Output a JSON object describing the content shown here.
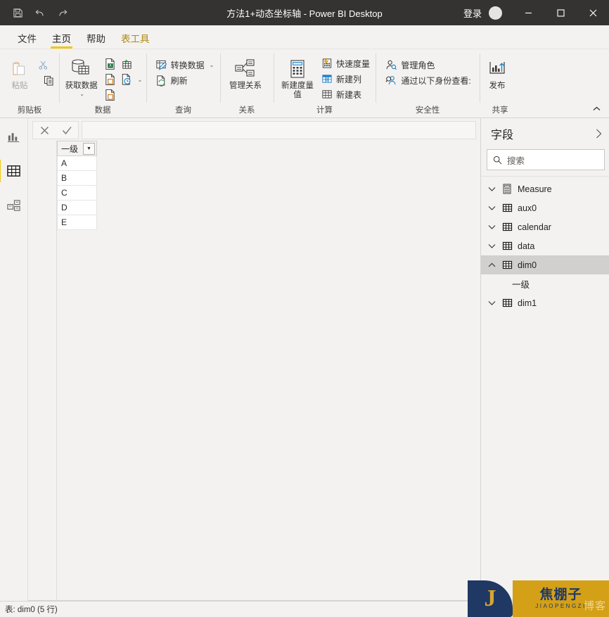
{
  "titlebar": {
    "save_icon": "save-icon",
    "undo_icon": "undo-icon",
    "redo_icon": "redo-icon",
    "title": "方法1+动态坐标轴 - Power BI Desktop",
    "signin_label": "登录",
    "minimize_label": "—",
    "maximize_label": "☐",
    "close_label": "✕"
  },
  "tabs": [
    {
      "label": "文件",
      "active": false,
      "tools": false
    },
    {
      "label": "主页",
      "active": true,
      "tools": false
    },
    {
      "label": "帮助",
      "active": false,
      "tools": false
    },
    {
      "label": "表工具",
      "active": false,
      "tools": true
    }
  ],
  "ribbon": {
    "collapse_icon": "chevron-up-icon",
    "groups": [
      {
        "name": "clipboard",
        "label": "剪贴板",
        "big_buttons": [
          {
            "label": "粘贴",
            "icon": "paste-icon",
            "disabled": true
          }
        ],
        "small_buttons": [
          {
            "label": "",
            "icon": "cut-scissors-icon"
          },
          {
            "label": "",
            "icon": "copy-icon"
          }
        ]
      },
      {
        "name": "data",
        "label": "数据",
        "big_buttons": [
          {
            "label": "获取数据",
            "icon": "get-data-icon",
            "disabled": false
          }
        ],
        "small_buttons": [
          {
            "label": "",
            "icon": "excel-workbook-icon"
          },
          {
            "label": "",
            "icon": "enter-data-icon"
          },
          {
            "label": "",
            "icon": "dataverse-icon"
          },
          {
            "label": "",
            "icon": "recent-sources-icon"
          },
          {
            "label": "",
            "icon": "sql-server-icon"
          }
        ]
      },
      {
        "name": "query",
        "label": "查询",
        "small_buttons": [
          {
            "label": "转换数据",
            "icon": "transform-data-icon",
            "has_chevron": true
          },
          {
            "label": "刷新",
            "icon": "refresh-icon",
            "has_chevron": false
          }
        ]
      },
      {
        "name": "relationships",
        "label": "关系",
        "big_buttons": [
          {
            "label": "管理关系",
            "icon": "manage-relationships-icon",
            "disabled": false
          }
        ]
      },
      {
        "name": "calculations",
        "label": "计算",
        "big_buttons": [
          {
            "label": "新建度量值",
            "icon": "new-measure-icon",
            "disabled": false
          }
        ],
        "small_buttons": [
          {
            "label": "快速度量",
            "icon": "quick-measure-icon"
          },
          {
            "label": "新建列",
            "icon": "new-column-icon"
          },
          {
            "label": "新建表",
            "icon": "new-table-icon"
          }
        ]
      },
      {
        "name": "security",
        "label": "安全性",
        "small_buttons": [
          {
            "label": "管理角色",
            "icon": "manage-roles-icon"
          },
          {
            "label": "通过以下身份查看:",
            "icon": "view-as-icon"
          }
        ]
      },
      {
        "name": "share",
        "label": "共享",
        "big_buttons": [
          {
            "label": "发布",
            "icon": "publish-icon",
            "disabled": false
          }
        ]
      }
    ]
  },
  "viewbar": {
    "items": [
      {
        "name": "report-view",
        "icon": "bar-chart-icon",
        "active": false
      },
      {
        "name": "data-view",
        "icon": "table-grid-icon",
        "active": true
      },
      {
        "name": "model-view",
        "icon": "model-relationship-icon",
        "active": false
      }
    ]
  },
  "formula_bar": {
    "cancel_icon": "cancel-x-icon",
    "confirm_icon": "confirm-check-icon",
    "value": "",
    "placeholder": ""
  },
  "grid": {
    "columns": [
      {
        "header": "一级",
        "filter_icon": "filter-dropdown-icon"
      }
    ],
    "rows": [
      [
        "A"
      ],
      [
        "B"
      ],
      [
        "C"
      ],
      [
        "D"
      ],
      [
        "E"
      ]
    ]
  },
  "fields_pane": {
    "title": "字段",
    "collapse_icon": "chevron-right-icon",
    "search": {
      "icon": "search-icon",
      "value": "",
      "placeholder": "搜索"
    },
    "items": [
      {
        "label": "Measure",
        "icon": "measure-icon",
        "chevron": "chevron-down-icon",
        "expanded": false,
        "selected": false,
        "children": []
      },
      {
        "label": "aux0",
        "icon": "table-icon",
        "chevron": "chevron-down-icon",
        "expanded": false,
        "selected": false,
        "children": []
      },
      {
        "label": "calendar",
        "icon": "table-icon",
        "chevron": "chevron-down-icon",
        "expanded": false,
        "selected": false,
        "children": []
      },
      {
        "label": "data",
        "icon": "table-icon",
        "chevron": "chevron-down-icon",
        "expanded": false,
        "selected": false,
        "children": []
      },
      {
        "label": "dim0",
        "icon": "table-icon",
        "chevron": "chevron-up-icon",
        "expanded": true,
        "selected": true,
        "children": [
          {
            "label": "一级"
          }
        ]
      },
      {
        "label": "dim1",
        "icon": "table-icon",
        "chevron": "chevron-down-icon",
        "expanded": false,
        "selected": false,
        "children": []
      }
    ]
  },
  "statusbar": {
    "text": "表: dim0 (5 行)"
  },
  "watermark": {
    "logo_letter": "J",
    "name_cn": "焦棚子",
    "name_en": "JIAOPENGZI",
    "overlay_text": "博客"
  },
  "colors": {
    "titlebar_bg": "#353332",
    "ribbon_bg": "#f3f2f1",
    "accent_yellow": "#f2c811",
    "tools_tab": "#b08c12",
    "selected_row": "#d2d0ce",
    "watermark_gold": "#d4a017",
    "watermark_navy": "#1f3864"
  }
}
